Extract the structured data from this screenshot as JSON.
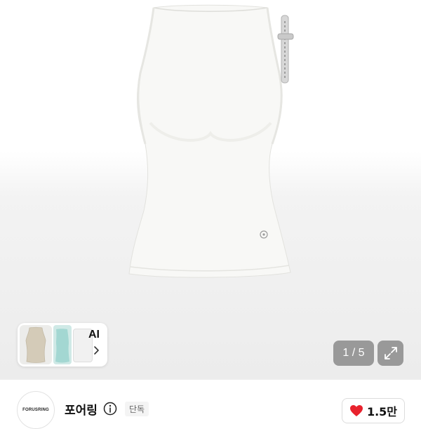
{
  "gallery": {
    "pager_text": "1 / 5",
    "ai_label": "AI",
    "expand_icon": "expand-icon",
    "chevron_icon": "chevron-right-icon"
  },
  "store": {
    "logo_text": "FORUSRING",
    "name": "포어링",
    "info_icon": "info-icon",
    "badge": "단독"
  },
  "like": {
    "icon": "heart-icon",
    "count": "1.5만",
    "color": "#e8222d"
  }
}
